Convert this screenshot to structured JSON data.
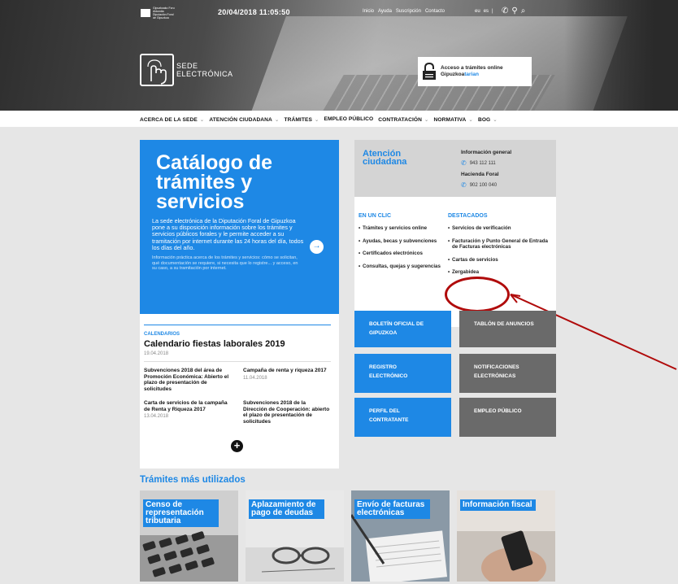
{
  "header": {
    "datetime": "20/04/2018 11:05:50",
    "links": [
      "Inicio",
      "Ayuda",
      "Suscripción",
      "Contacto"
    ],
    "languages": [
      "eu",
      "es"
    ],
    "logo_line1": "SEDE",
    "logo_line2": "ELECTRÓNICA",
    "access": {
      "line1": "Acceso a trámites online",
      "line2_a": "Gipuzkoa",
      "line2_b": "tarian"
    }
  },
  "nav": {
    "items": [
      "ACERCA DE LA SEDE",
      "ATENCIÓN CIUDADANA",
      "TRÁMITES",
      "EMPLEO PÚBLICO",
      "CONTRATACIÓN",
      "NORMATIVA",
      "BOG"
    ]
  },
  "catalog": {
    "title_lines": [
      "Catálogo de",
      "trámites y",
      "servicios"
    ],
    "description": "La sede electrónica de la Diputación Foral de Gipuzkoa pone a su disposición información sobre los trámites y servicios públicos forales y le permite acceder a su tramitación por internet durante las 24 horas del día, todos los días del año.",
    "small": "Información práctica acerca de los trámites y servicios: cómo se solicitan, qué documentación se requiere, si necesita que lo registre... y acceso, en su caso, a su tramitación por internet."
  },
  "atencion": {
    "title_lines": [
      "Atención",
      "ciudadana"
    ],
    "general_label": "Información general",
    "general_phone": "943 112 111",
    "hacienda_label": "Hacienda Foral",
    "hacienda_phone": "902 100 040"
  },
  "clics": {
    "en_un_clic_title": "EN UN CLIC",
    "en_un_clic": [
      "Trámites y servicios online",
      "Ayudas, becas y subvenciones",
      "Certificados electrónicos",
      "Consultas, quejas y sugerencias"
    ],
    "destacados_title": "DESTACADOS",
    "destacados": [
      "Servicios de verificación",
      "Facturación y Punto General de Entrada de Facturas electrónicas",
      "Cartas de servicios",
      "Zergabidea"
    ]
  },
  "tiles": [
    {
      "line1": "BOLETÍN OFICIAL DE",
      "line2": "GIPUZKOA",
      "color": "#1e88e5"
    },
    {
      "line1": "TABLÓN DE ANUNCIOS",
      "line2": "",
      "color": "#6a6a6a"
    },
    {
      "line1": "REGISTRO",
      "line2": "ELECTRÓNICO",
      "color": "#1e88e5"
    },
    {
      "line1": "NOTIFICACIONES",
      "line2": "ELECTRÓNICAS",
      "color": "#6a6a6a"
    },
    {
      "line1": "PERFIL DEL",
      "line2": "CONTRATANTE",
      "color": "#1e88e5"
    },
    {
      "line1": "EMPLEO PÚBLICO",
      "line2": "",
      "color": "#6a6a6a"
    }
  ],
  "news": {
    "category": "CALENDARIOS",
    "headline": "Calendario fiestas laborales 2019",
    "headline_date": "19.04.2018",
    "items": [
      {
        "title": "Subvenciones 2018 del área de Promoción Económica: Abierto el plazo de presentación de solicitudes",
        "date": ""
      },
      {
        "title": "Campaña de renta y riqueza 2017",
        "date": "11.04.2018"
      },
      {
        "title": "Carta de servicios de la campaña de Renta y Riqueza 2017",
        "date": "13.04.2018"
      },
      {
        "title": "Subvenciones 2018 de la Dirección de Cooperación: abierto el plazo de presentación de solicitudes",
        "date": ""
      }
    ]
  },
  "tramites": {
    "title": "Trámites más utilizados",
    "cards": [
      "Censo de representación tributaria",
      "Aplazamiento de pago de deudas",
      "Envío de facturas electrónicas",
      "Información fiscal"
    ]
  },
  "colors": {
    "accent": "#1e88e5",
    "annotation": "#b00b0b"
  }
}
